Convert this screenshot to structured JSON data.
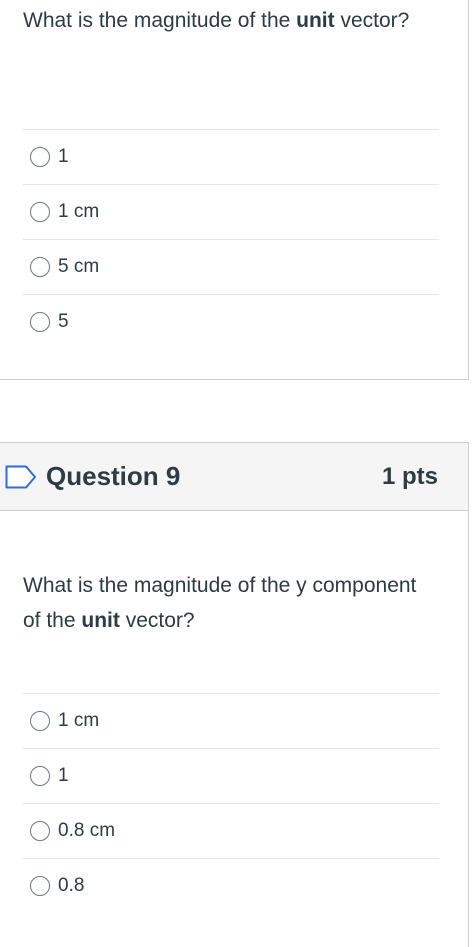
{
  "question_8": {
    "text_parts": [
      "What is the magnitude of the ",
      "unit",
      " vector?"
    ],
    "answers": [
      "1",
      "1 cm",
      "5 cm",
      "5"
    ]
  },
  "question_9": {
    "title": "Question 9",
    "points": "1 pts",
    "text_parts": [
      "What is the magnitude of the y component of the ",
      "unit",
      " vector?"
    ],
    "answers": [
      "1 cm",
      "1",
      "0.8 cm",
      "0.8"
    ]
  },
  "colors": {
    "text": "#2d3b45",
    "border": "#c7cdd1",
    "header_bg": "#f5f5f5",
    "flag_stroke": "#2d6ae3"
  }
}
